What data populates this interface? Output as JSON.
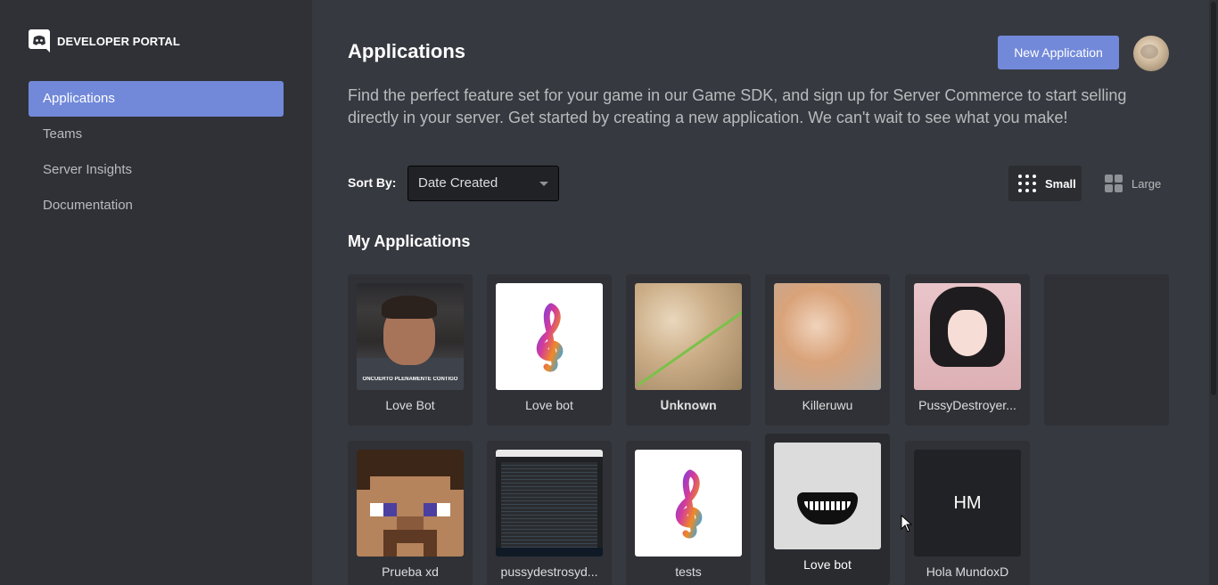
{
  "sidebar": {
    "brand": "DEVELOPER PORTAL",
    "brand_icon": "discord-logo-icon",
    "items": [
      {
        "label": "Applications",
        "active": true
      },
      {
        "label": "Teams",
        "active": false
      },
      {
        "label": "Server Insights",
        "active": false
      },
      {
        "label": "Documentation",
        "active": false
      }
    ]
  },
  "header": {
    "title": "Applications",
    "new_app_label": "New Application",
    "description": "Find the perfect feature set for your game in our Game SDK, and sign up for Server Commerce to start selling directly in your server. Get started by creating a new application. We can't wait to see what you make!"
  },
  "sort": {
    "label": "Sort By:",
    "selected": "Date Created"
  },
  "view_toggle": {
    "small_label": "Small",
    "large_label": "Large",
    "selected": "Small"
  },
  "section": {
    "title": "My Applications"
  },
  "applications": [
    {
      "name": "Love Bot"
    },
    {
      "name": "Love bot"
    },
    {
      "name": "𝐔𝐧𝐤𝐧𝐨𝐰𝐧"
    },
    {
      "name": "Killeruwu"
    },
    {
      "name": "PussyDestroyer..."
    },
    {
      "name": "Prueba xd"
    },
    {
      "name": "pussydestrosyd..."
    },
    {
      "name": "tests"
    },
    {
      "name": "Love bot"
    },
    {
      "name": "Hola MundoxD",
      "initials": "HM"
    }
  ],
  "thumbnail_caption": "ONCUERTO PLENAMENTE CONTIGO",
  "colors": {
    "accent": "#7289da",
    "background": "#36393f",
    "sidebar": "#2f3136",
    "card": "#2f3136"
  }
}
